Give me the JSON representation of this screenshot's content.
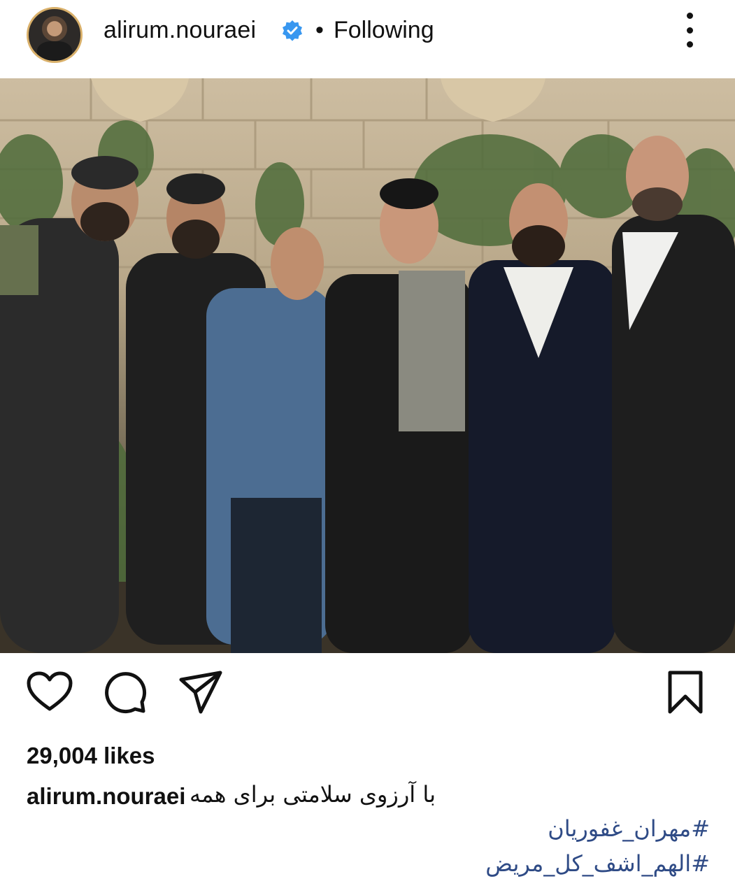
{
  "post_header": {
    "username": "alirum.nouraei",
    "separator": "•",
    "follow_status": "Following"
  },
  "actions": {
    "like_icon": "heart-icon",
    "comment_icon": "comment-icon",
    "share_icon": "send-icon",
    "save_icon": "bookmark-icon"
  },
  "likes": {
    "text": "29,004 likes"
  },
  "caption": {
    "username": "alirum.nouraei",
    "text": "با آرزوی سلامتی برای همه",
    "hashtags": [
      "#مهران_غفوریان",
      "#الهم_اشف_کل_مریض"
    ]
  },
  "colors": {
    "verified_badge": "#3897f0",
    "hashtag": "#2f4b86"
  }
}
